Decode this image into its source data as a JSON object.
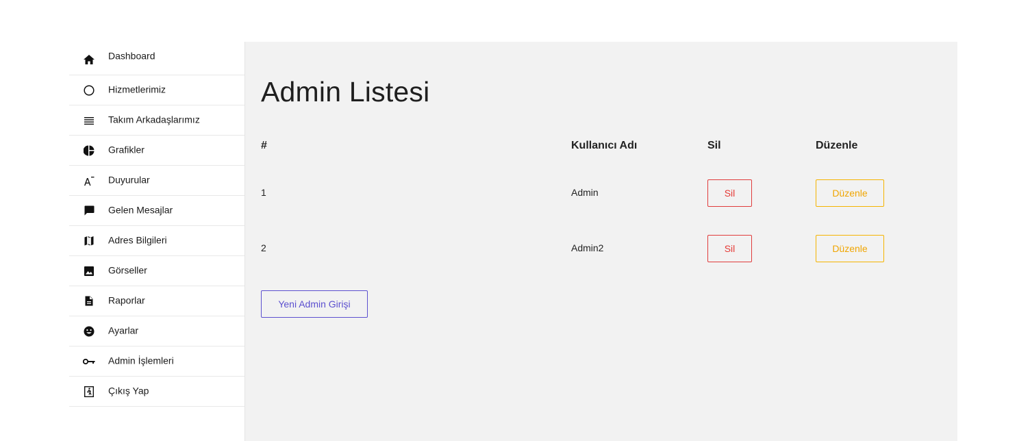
{
  "sidebar": {
    "items": [
      {
        "label": "Dashboard",
        "icon": "home-icon"
      },
      {
        "label": "Hizmetlerimiz",
        "icon": "circle-icon"
      },
      {
        "label": "Takım Arkadaşlarımız",
        "icon": "list-icon"
      },
      {
        "label": "Grafikler",
        "icon": "pie-chart-icon"
      },
      {
        "label": "Duyurular",
        "icon": "text-format-icon"
      },
      {
        "label": "Gelen Mesajlar",
        "icon": "chat-icon"
      },
      {
        "label": "Adres Bilgileri",
        "icon": "map-icon"
      },
      {
        "label": "Görseller",
        "icon": "image-icon"
      },
      {
        "label": "Raporlar",
        "icon": "document-icon"
      },
      {
        "label": "Ayarlar",
        "icon": "smiley-icon"
      },
      {
        "label": "Admin İşlemleri",
        "icon": "key-icon"
      },
      {
        "label": "Çıkış Yap",
        "icon": "exit-icon"
      }
    ]
  },
  "main": {
    "title": "Admin Listesi",
    "table": {
      "headers": [
        "#",
        "Kullanıcı Adı",
        "Sil",
        "Düzenle"
      ],
      "rows": [
        {
          "id": "1",
          "username": "Admin",
          "delete_label": "Sil",
          "edit_label": "Düzenle"
        },
        {
          "id": "2",
          "username": "Admin2",
          "delete_label": "Sil",
          "edit_label": "Düzenle"
        }
      ]
    },
    "new_admin_label": "Yeni Admin Girişi"
  },
  "colors": {
    "danger": "#e53935",
    "warning": "#f0a500",
    "primary": "#5b4fcf",
    "main_bg": "#f2f2f2"
  }
}
